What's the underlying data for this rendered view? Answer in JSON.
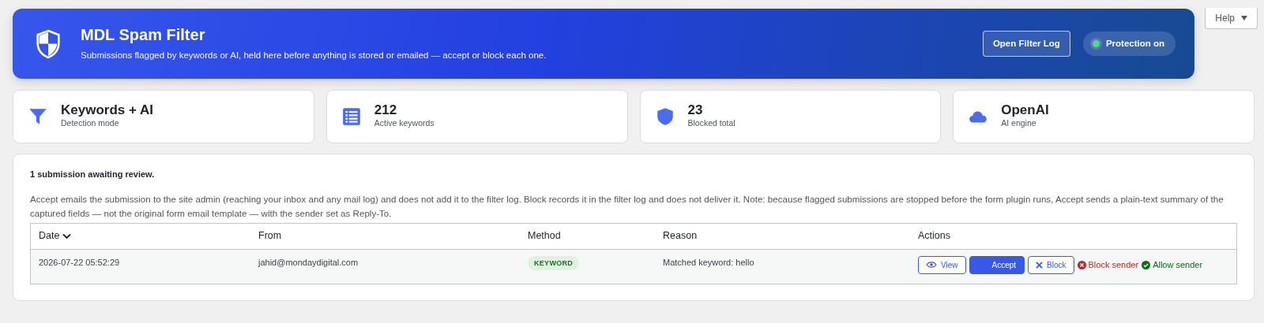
{
  "help_button": {
    "label": "Help"
  },
  "header": {
    "title": "MDL Spam Filter",
    "subtitle": "Submissions flagged by keywords or AI, held here before anything is stored or emailed — accept or block each one.",
    "log_button": "Open Filter Log",
    "protection": {
      "label": "Protection on",
      "on": true
    }
  },
  "stats": [
    {
      "kind": "funnel",
      "value": "Keywords + AI",
      "label": "Detection mode"
    },
    {
      "kind": "list",
      "value": "212",
      "label": "Active keywords"
    },
    {
      "kind": "shield",
      "value": "23",
      "label": "Blocked total"
    },
    {
      "kind": "cloud",
      "value": "OpenAI",
      "label": "AI engine"
    }
  ],
  "review": {
    "summary": "1 submission awaiting review.",
    "note": "Accept emails the submission to the site admin (reaching your inbox and any mail log) and does not add it to the filter log. Block records it in the filter log and does not deliver it. Note: because flagged submissions are stopped before the form plugin runs, Accept sends a plain-text summary of the captured fields — not the original form email template — with the sender set as Reply-To.",
    "table": {
      "columns": [
        {
          "label": "Date",
          "sorted": true
        },
        {
          "label": "From",
          "sorted": false
        },
        {
          "label": "Method",
          "sorted": false
        },
        {
          "label": "Reason",
          "sorted": false
        },
        {
          "label": "Actions",
          "sorted": false
        }
      ],
      "rows": [
        {
          "date": "2026-07-22 05:52:29",
          "from": "jahid@mondaydigital.com",
          "method": "KEYWORD",
          "reason": "Matched keyword: hello",
          "actions": {
            "view": "View",
            "accept": "Accept",
            "block": "Block",
            "block_sender": "Block sender",
            "allow_sender": "Allow sender"
          }
        }
      ]
    }
  }
}
